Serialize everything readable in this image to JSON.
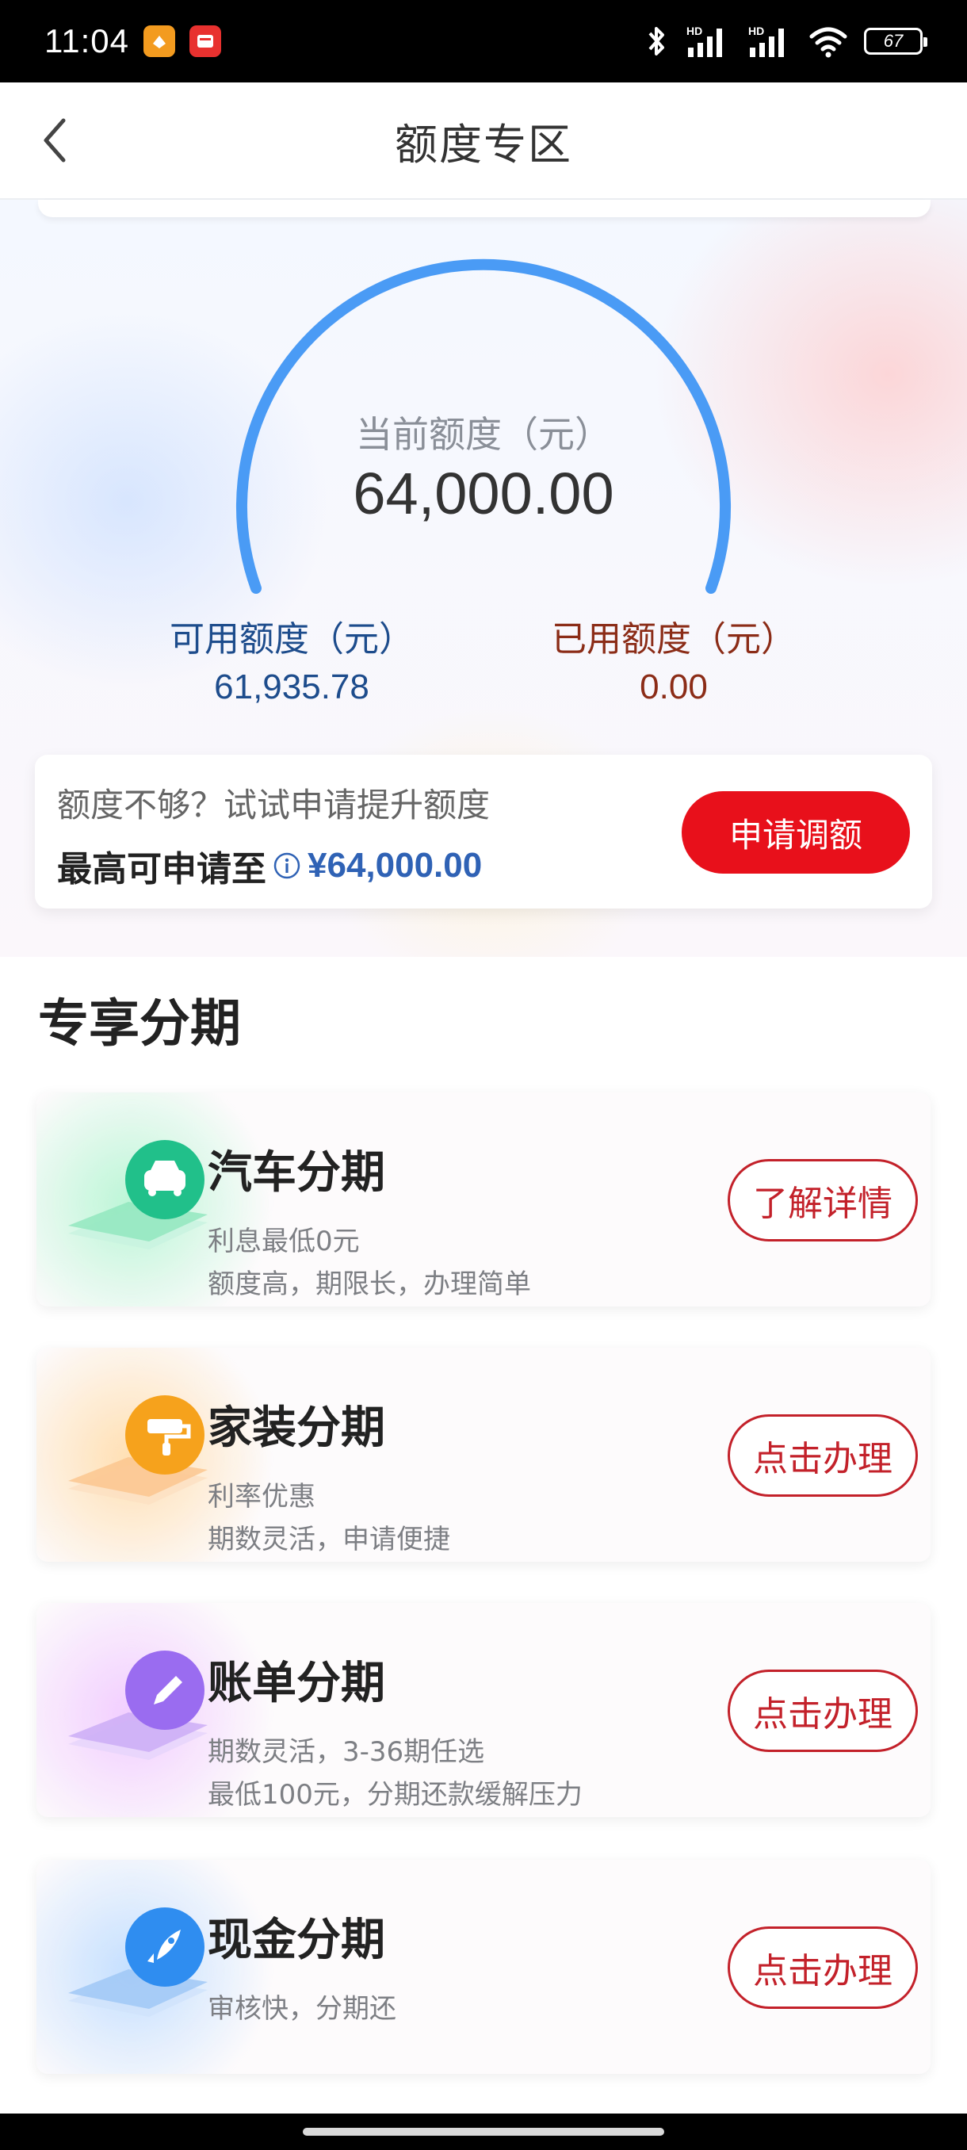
{
  "status_bar": {
    "time": "11:04",
    "battery": "67",
    "network": "HD",
    "icons": [
      "bluetooth-icon",
      "signal-icon",
      "signal-icon",
      "wifi-icon"
    ]
  },
  "nav": {
    "title": "额度专区",
    "back_icon": "chevron-left-icon"
  },
  "gauge": {
    "label": "当前额度（元）",
    "value": "64,000.00",
    "arc_color": "#4a9bf5"
  },
  "stats": {
    "available_label": "可用额度（元）",
    "available_value": "61,935.78",
    "used_label": "已用额度（元）",
    "used_value": "0.00"
  },
  "raise": {
    "hint": "额度不够？试试申请提升额度",
    "max_label": "最高可申请至",
    "max_amount": "¥64,000.00",
    "button": "申请调额",
    "button_color": "#e8101b"
  },
  "section": {
    "title": "专享分期"
  },
  "plans": [
    {
      "title": "汽车分期",
      "desc1": "利息最低0元",
      "desc2": "额度高，期限长，办理简单",
      "button": "了解详情",
      "icon": "car-icon",
      "color": "#21c08a"
    },
    {
      "title": "家装分期",
      "desc1": "利率优惠",
      "desc2": "期数灵活，申请便捷",
      "button": "点击办理",
      "icon": "paint-roller-icon",
      "color": "#f6a21c"
    },
    {
      "title": "账单分期",
      "desc1": "期数灵活，3-36期任选",
      "desc2": "最低100元，分期还款缓解压力",
      "button": "点击办理",
      "icon": "pencil-icon",
      "color": "#9a6cf0"
    },
    {
      "title": "现金分期",
      "desc1": "审核快，分期还",
      "desc2": "",
      "button": "点击办理",
      "icon": "rocket-icon",
      "color": "#2f8df0"
    }
  ]
}
